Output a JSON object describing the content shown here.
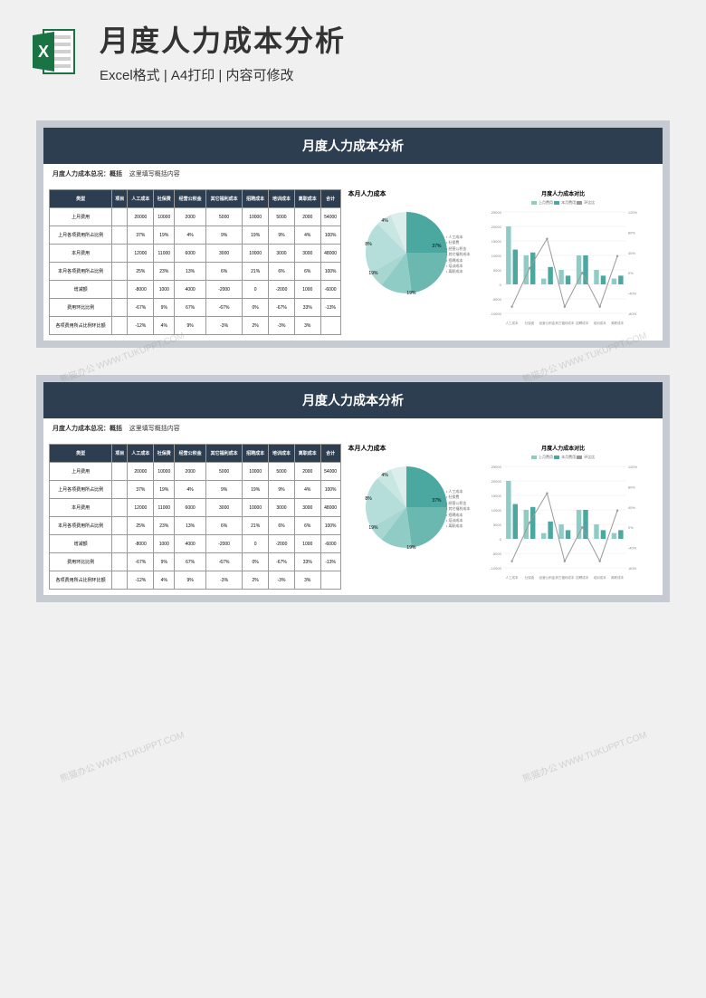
{
  "header": {
    "main_title": "月度人力成本分析",
    "sub_title": "Excel格式 | A4打印 | 内容可修改"
  },
  "banner_title": "月度人力成本分析",
  "overview": {
    "label": "月度人力成本总况：概括",
    "content": "这里填写概括内容"
  },
  "table": {
    "headers": [
      "类型",
      "项目",
      "人工成本",
      "社保费",
      "经营公积金",
      "其它福利成本",
      "招聘成本",
      "培训成本",
      "离职成本",
      "合计"
    ],
    "rows": [
      {
        "label": "上月费用",
        "cells": [
          "",
          "20000",
          "10000",
          "2000",
          "5000",
          "10000",
          "5000",
          "2000",
          "54000"
        ]
      },
      {
        "label": "上月各项费用所占比例",
        "cells": [
          "",
          "37%",
          "19%",
          "4%",
          "9%",
          "19%",
          "9%",
          "4%",
          "100%"
        ]
      },
      {
        "label": "本月费用",
        "cells": [
          "",
          "12000",
          "11000",
          "6000",
          "3000",
          "10000",
          "3000",
          "3000",
          "48000"
        ]
      },
      {
        "label": "本月各项费用所占比例",
        "cells": [
          "",
          "25%",
          "23%",
          "13%",
          "6%",
          "21%",
          "6%",
          "6%",
          "100%"
        ]
      },
      {
        "label": "增减额",
        "cells": [
          "",
          "-8000",
          "1000",
          "4000",
          "-2000",
          "0",
          "-2000",
          "1000",
          "-6000"
        ]
      },
      {
        "label": "费用环比比例",
        "cells": [
          "",
          "-67%",
          "9%",
          "67%",
          "-67%",
          "0%",
          "-67%",
          "33%",
          "-13%"
        ]
      },
      {
        "label": "各项费用所占比例环比额",
        "cells": [
          "",
          "-12%",
          "4%",
          "9%",
          "-3%",
          "2%",
          "-3%",
          "3%",
          ""
        ]
      }
    ]
  },
  "pie": {
    "title": "本月人力成本",
    "legend_items": [
      "人工成本",
      "社保费",
      "经营公积金",
      "其它福利成本",
      "招聘成本",
      "培训成本",
      "离职成本"
    ],
    "labels": [
      "37%",
      "19%",
      "19%",
      "8%",
      "4%"
    ]
  },
  "bar": {
    "title": "月度人力成本对比",
    "legend": [
      "上月费用",
      "本月费用",
      "环比比"
    ],
    "categories": [
      "人工成本",
      "社保费",
      "经营公积金",
      "其它福利成本",
      "招聘成本",
      "培训成本",
      "离职成本"
    ],
    "y_left": [
      "25000",
      "20000",
      "15000",
      "10000",
      "5000",
      "0",
      "-5000",
      "-10000"
    ],
    "y_right": [
      "120%",
      "80%",
      "40%",
      "0%",
      "-40%",
      "-80%"
    ]
  },
  "chart_data": [
    {
      "type": "pie",
      "title": "本月人力成本",
      "categories": [
        "人工成本",
        "社保费",
        "经营公积金",
        "其它福利成本",
        "招聘成本",
        "培训成本",
        "离职成本"
      ],
      "values": [
        12000,
        11000,
        6000,
        3000,
        10000,
        3000,
        3000
      ],
      "percents": [
        25,
        23,
        13,
        6,
        21,
        6,
        6
      ]
    },
    {
      "type": "bar",
      "title": "月度人力成本对比",
      "categories": [
        "人工成本",
        "社保费",
        "经营公积金",
        "其它福利成本",
        "招聘成本",
        "培训成本",
        "离职成本"
      ],
      "series": [
        {
          "name": "上月费用",
          "values": [
            20000,
            10000,
            2000,
            5000,
            10000,
            5000,
            2000
          ]
        },
        {
          "name": "本月费用",
          "values": [
            12000,
            11000,
            6000,
            3000,
            10000,
            3000,
            3000
          ]
        },
        {
          "name": "环比比",
          "values": [
            -67,
            9,
            67,
            -67,
            0,
            -67,
            33
          ],
          "type": "line",
          "axis": "right"
        }
      ],
      "ylim_left": [
        -10000,
        25000
      ],
      "ylim_right": [
        -80,
        120
      ]
    }
  ],
  "watermark": "熊猫办公 WWW.TUKUPPT.COM",
  "colors": {
    "dark": "#2c3e50",
    "teal": "#4aa8a0",
    "teal_light": "#8fccc6",
    "teal_pale": "#b5ddd9"
  }
}
